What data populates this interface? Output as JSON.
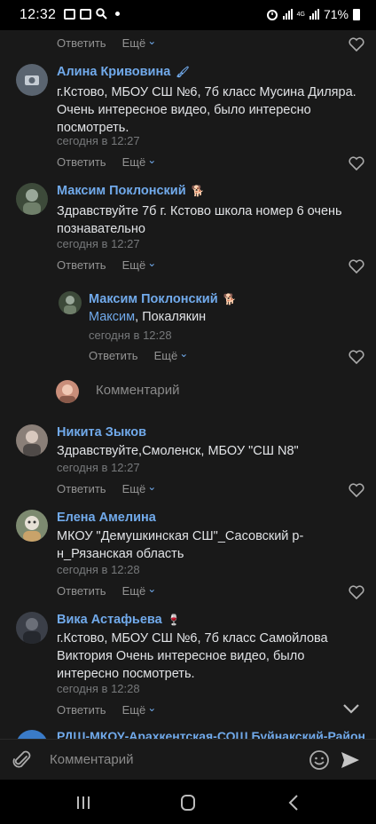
{
  "status_bar": {
    "time": "12:32",
    "battery": "71%",
    "network": "4G"
  },
  "top_actions": {
    "reply": "Ответить",
    "more": "Ещё"
  },
  "comments": [
    {
      "author": "Алина Кривовина",
      "emoji": "🖌",
      "text": "г.Кстово, МБОУ СШ №6, 7б класс Мусина Диляра. Очень интересное видео, было интересно посмотреть.",
      "date": "сегодня в 12:27",
      "reply": "Ответить",
      "more": "Ещё"
    },
    {
      "author": "Максим Поклонский",
      "emoji": "🐕",
      "text": "Здравствуйте 7б г. Кстово школа номер 6 очень познавательно",
      "date": "сегодня в 12:27",
      "reply": "Ответить",
      "more": "Ещё"
    },
    {
      "author": "Никита Зыков",
      "emoji": "",
      "text": "Здравствуйте,Смоленск, МБОУ \"СШ N8\"",
      "date": "сегодня в 12:27",
      "reply": "Ответить",
      "more": "Ещё"
    },
    {
      "author": "Елена Амелина",
      "emoji": "",
      "text": "МКОУ \"Демушкинская СШ\"_Сасовский р-н_Рязанская область",
      "date": "сегодня в 12:28",
      "reply": "Ответить",
      "more": "Ещё"
    },
    {
      "author": "Вика Астафьева",
      "emoji": "🍷",
      "text": "г.Кстово, МБОУ СШ №6, 7б класс Самойлова Виктория Очень интересное видео, было интересно посмотреть.",
      "date": "сегодня в 12:28",
      "reply": "Ответить",
      "more": "Ещё"
    }
  ],
  "reply": {
    "author": "Максим Поклонский",
    "emoji": "🐕",
    "mention": "Максим",
    "text": ", Покалякин",
    "date": "сегодня в 12:28",
    "reply": "Ответить",
    "more": "Ещё"
  },
  "inline_comment_placeholder": "Комментарий",
  "cut_off_author": "РДШ-МКОУ-Арахкентская-СОШ Буйнакский-Район",
  "composer": {
    "placeholder": "Комментарий"
  },
  "colors": {
    "background": "#191919",
    "link": "#71aaeb",
    "text": "#e1e3e6",
    "muted": "#76787a"
  }
}
